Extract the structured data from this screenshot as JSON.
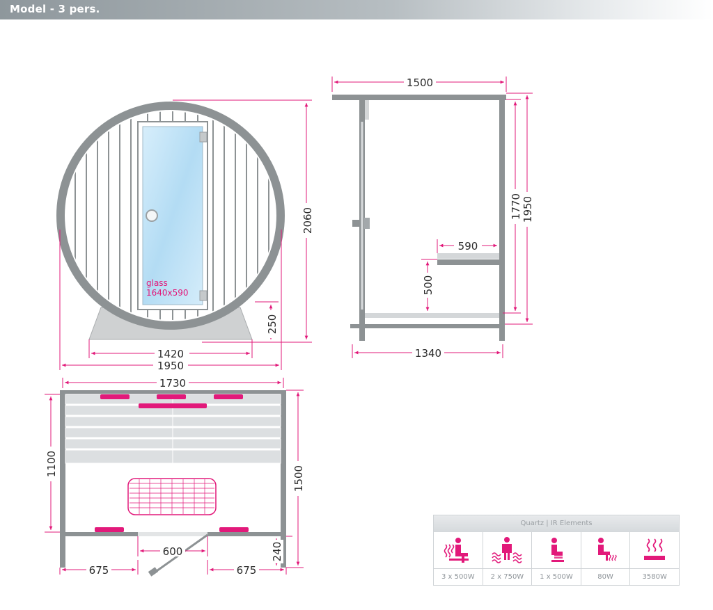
{
  "header": {
    "title": "Model - 3 pers."
  },
  "front_view": {
    "height": "2060",
    "base_height": "250",
    "base_width": "1420",
    "total_width": "1950",
    "glass_label": "glass",
    "glass_size": "1640x590"
  },
  "side_view": {
    "top_width": "1500",
    "inner_height": "1770",
    "total_height": "1950",
    "bench_depth": "590",
    "bench_height": "500",
    "floor_length": "1340"
  },
  "plan_view": {
    "width": "1730",
    "bench_length": "1100",
    "total_length": "1500",
    "door_width": "600",
    "side_left": "675",
    "side_right": "675",
    "wall_offset": "240"
  },
  "legend": {
    "title": "Quartz  |  IR Elements",
    "items": [
      {
        "icon": "seated-back-heater-icon",
        "watt": "3 x 500W"
      },
      {
        "icon": "standing-person-heaters-icon",
        "watt": "2 x 750W"
      },
      {
        "icon": "seated-front-heater-icon",
        "watt": "1 x 500W"
      },
      {
        "icon": "seated-foot-heater-icon",
        "watt": "80W"
      },
      {
        "icon": "total-heat-icon",
        "watt": "3580W"
      }
    ],
    "accent_color": "#e2197a"
  }
}
